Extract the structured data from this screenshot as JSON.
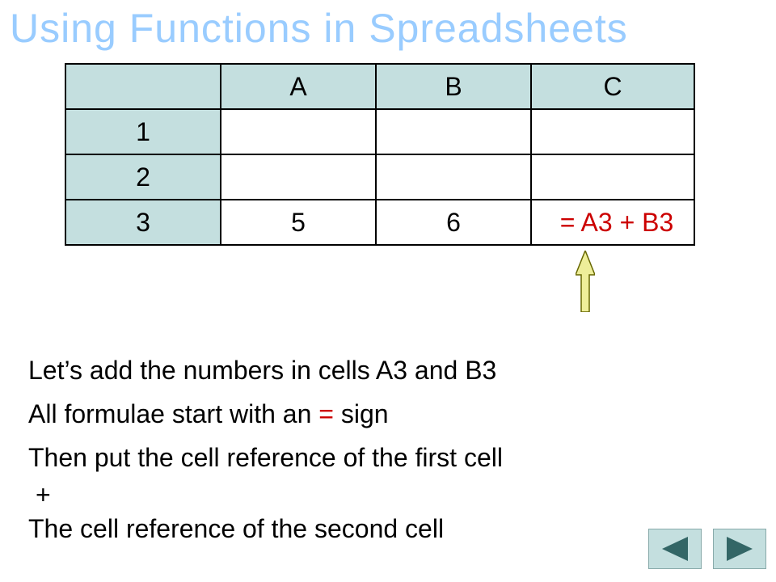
{
  "title": "Using Functions in Spreadsheets",
  "table": {
    "columns": [
      "A",
      "B",
      "C"
    ],
    "rows": [
      {
        "hdr": "1",
        "a": "",
        "b": "",
        "c": ""
      },
      {
        "hdr": "2",
        "a": "",
        "b": "",
        "c": ""
      },
      {
        "hdr": "3",
        "a": "5",
        "b": "6",
        "c": "= A3 + B3"
      }
    ]
  },
  "text": {
    "line1": "Let’s add the numbers in cells A3 and B3",
    "line2a": "All formulae start with an ",
    "line2b": "=",
    "line2c": " sign",
    "line3": "Then put the cell reference of the first cell",
    "line4": "+",
    "line5": "The cell reference of the second cell"
  },
  "colors": {
    "title": "#99ccff",
    "header_fill": "#c4dfdf",
    "formula_red": "#cc0000",
    "arrow_fill": "#eeee99",
    "nav_fill": "#c4dfdf",
    "nav_tri": "#336666"
  },
  "nav": {
    "prev_label": "Previous",
    "next_label": "Next"
  }
}
